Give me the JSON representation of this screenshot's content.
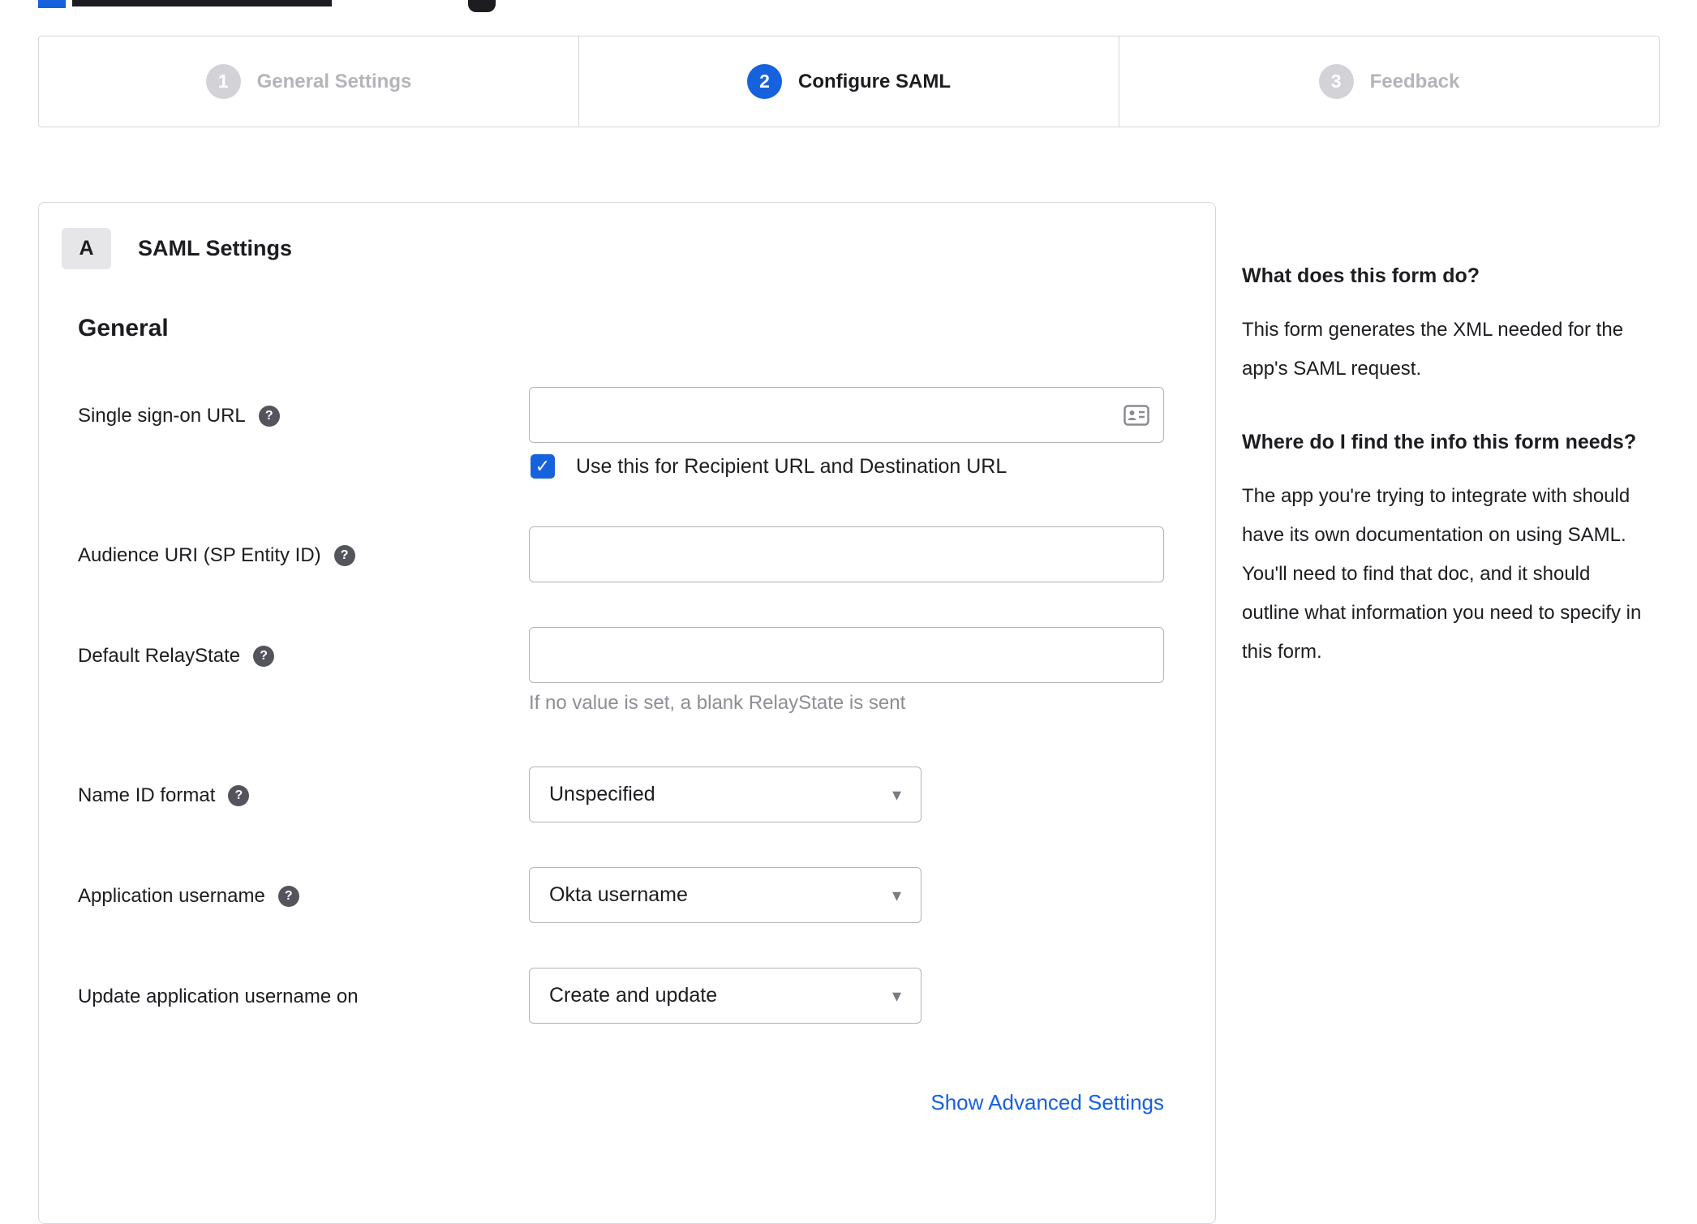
{
  "stepper": {
    "steps": [
      {
        "number": "1",
        "label": "General Settings",
        "state": "inactive"
      },
      {
        "number": "2",
        "label": "Configure SAML",
        "state": "active"
      },
      {
        "number": "3",
        "label": "Feedback",
        "state": "inactive"
      }
    ]
  },
  "form": {
    "section_badge": "A",
    "section_title": "SAML Settings",
    "group_title": "General",
    "sso_url": {
      "label": "Single sign-on URL",
      "value": ""
    },
    "sso_checkbox": {
      "label": "Use this for Recipient URL and Destination URL",
      "checked": true
    },
    "audience_uri": {
      "label": "Audience URI (SP Entity ID)",
      "value": ""
    },
    "relay_state": {
      "label": "Default RelayState",
      "value": "",
      "hint": "If no value is set, a blank RelayState is sent"
    },
    "name_id_format": {
      "label": "Name ID format",
      "value": "Unspecified"
    },
    "app_username": {
      "label": "Application username",
      "value": "Okta username"
    },
    "update_app_username": {
      "label": "Update application username on",
      "value": "Create and update"
    },
    "advanced_link": "Show Advanced Settings"
  },
  "sidebar": {
    "sections": [
      {
        "title": "What does this form do?",
        "body": "This form generates the XML needed for the app's SAML request."
      },
      {
        "title": "Where do I find the info this form needs?",
        "body": "The app you're trying to integrate with should have its own documentation on using SAML. You'll need to find that doc, and it should outline what information you need to specify in this form."
      }
    ]
  },
  "icons": {
    "help": "?",
    "caret": "▾",
    "check": "✓"
  },
  "colors": {
    "accent_blue": "#1662dd",
    "inactive_gray": "#d2d2d7",
    "border_gray": "#d8d8dc",
    "link_blue": "#1662dd"
  }
}
